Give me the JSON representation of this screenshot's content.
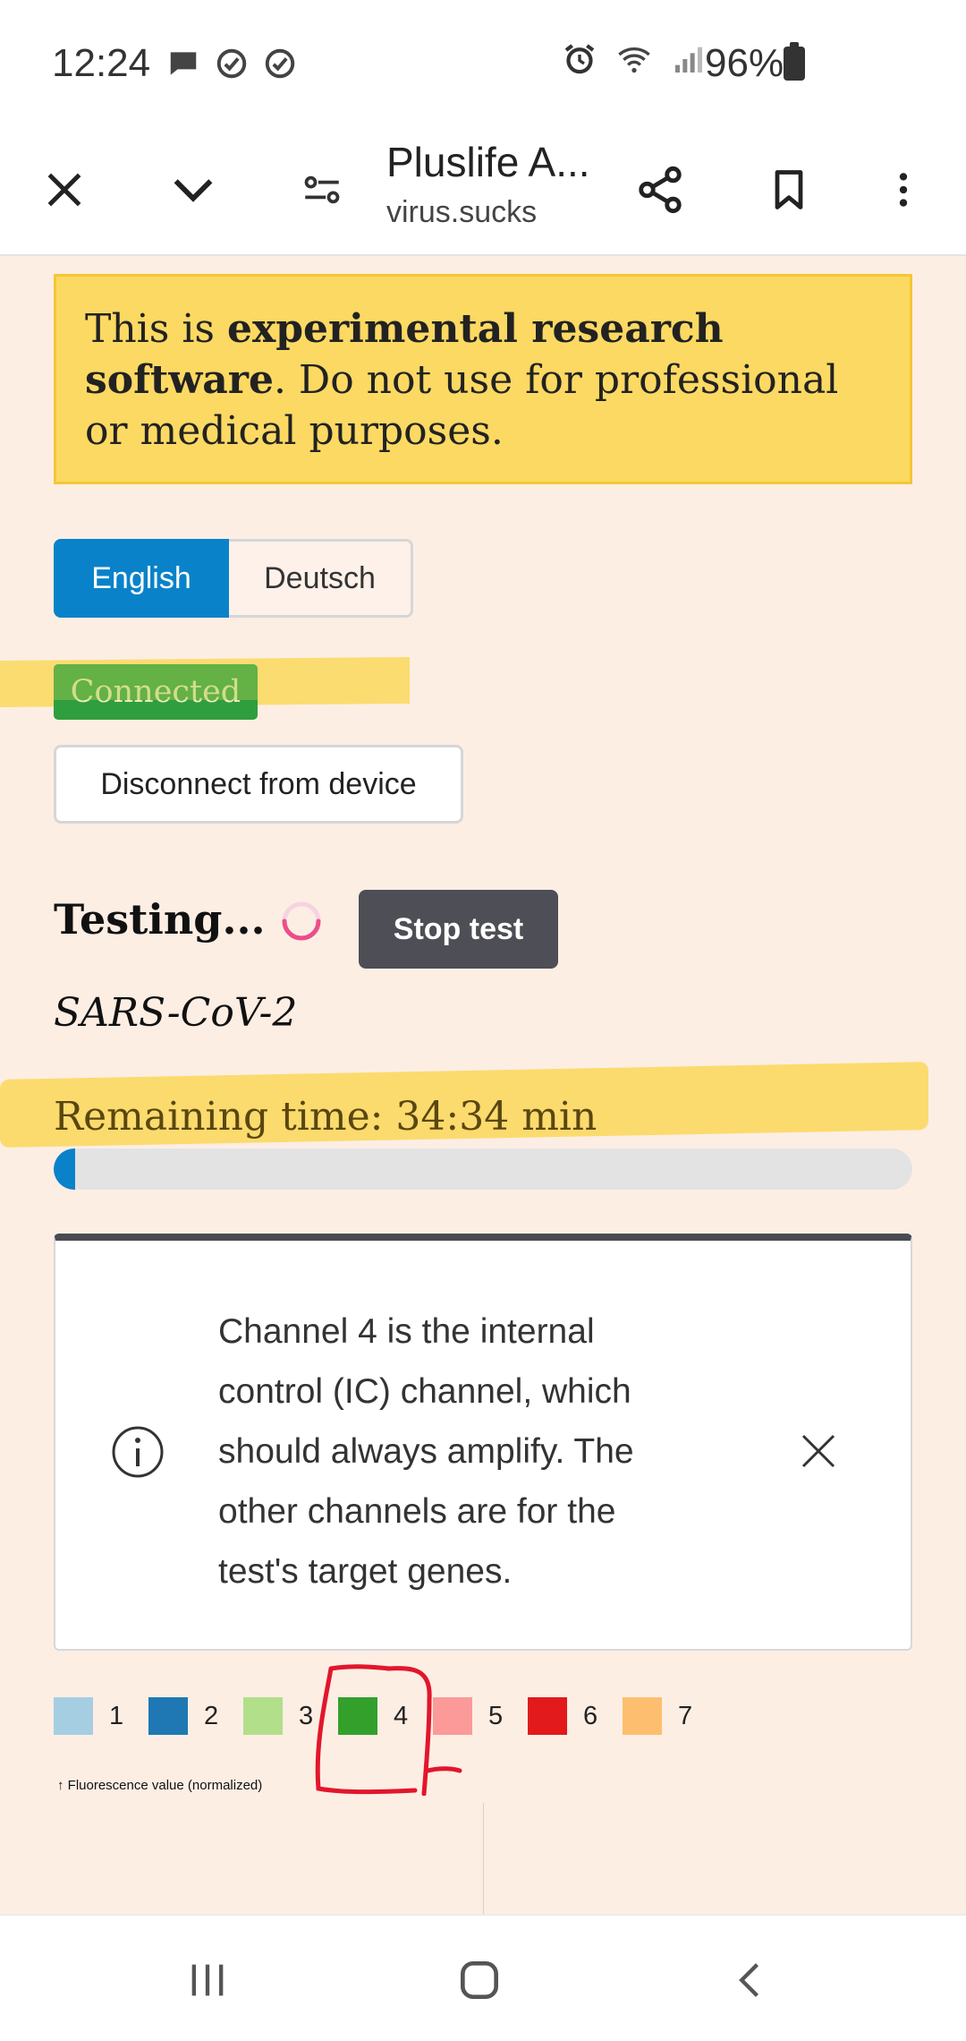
{
  "status_bar": {
    "time": "12:24",
    "battery": "96%",
    "icons_left": [
      "chat-bubble-icon",
      "check-circle-icon",
      "check-circle-icon"
    ],
    "icons_right": [
      "alarm-icon",
      "wifi-icon",
      "signal-icon",
      "battery-icon"
    ]
  },
  "browser": {
    "title": "Pluslife A...",
    "url": "virus.sucks",
    "icons": [
      "close-icon",
      "chevron-down-icon",
      "site-settings-icon",
      "share-icon",
      "bookmark-icon",
      "more-vert-icon"
    ]
  },
  "banner": {
    "prefix": "This is ",
    "bold": "experimental research software",
    "suffix": ". Do not use for professional or medical purposes."
  },
  "language": {
    "options": [
      "English",
      "Deutsch"
    ],
    "selected": "English"
  },
  "connection": {
    "status": "Connected",
    "disconnect_label": "Disconnect from device"
  },
  "test": {
    "status": "Testing...",
    "stop_label": "Stop test",
    "name": "SARS-CoV-2",
    "remaining": "Remaining time: 34:34 min",
    "progress": 0.025
  },
  "info": {
    "text": "Channel 4 is the internal control (IC) channel, which should always amplify. The other channels are for the test's target genes."
  },
  "legend": {
    "items": [
      {
        "label": "1",
        "color": "#a6cee3"
      },
      {
        "label": "2",
        "color": "#1f78b4"
      },
      {
        "label": "3",
        "color": "#b2df8a"
      },
      {
        "label": "4",
        "color": "#33a02c"
      },
      {
        "label": "5",
        "color": "#fb9a99"
      },
      {
        "label": "6",
        "color": "#e31a1c"
      },
      {
        "label": "7",
        "color": "#fdbf6f"
      }
    ]
  },
  "chart": {
    "y_axis_label": "↑ Fluorescence value (normalized)"
  },
  "colors": {
    "accent": "#0a82c9",
    "connected": "#2f9e3f",
    "highlight": "#fbd963",
    "page_bg": "#fdeee4",
    "annotation": "#e3152b"
  },
  "nav": {
    "icons": [
      "recent-apps-icon",
      "home-icon",
      "back-icon"
    ]
  }
}
